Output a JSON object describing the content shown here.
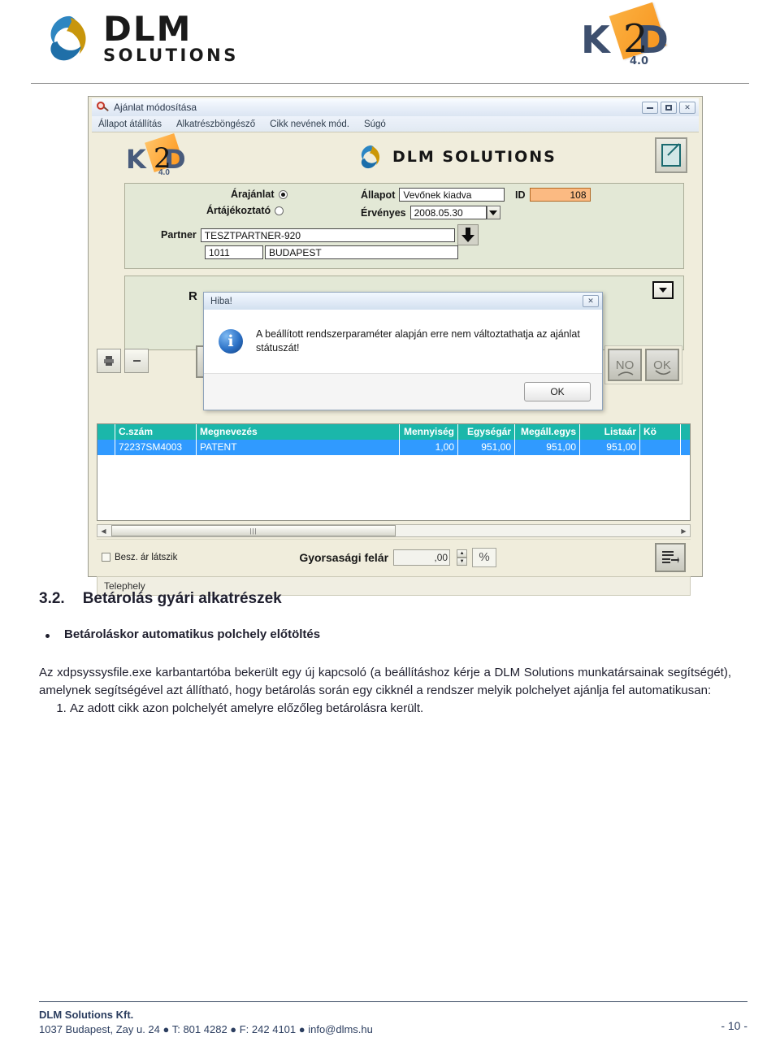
{
  "brand": {
    "dlm_top": "DLM",
    "dlm_bottom": "SOLUTIONS",
    "k2d_text": "KD",
    "k2d_two": "2",
    "k2d_version": "4.0"
  },
  "screenshot": {
    "window": {
      "title": "Ajánlat módosítása",
      "icon": "magnifier-icon",
      "buttons": {
        "minimize": "minimize-icon",
        "maximize": "maximize-icon",
        "close": "✕"
      },
      "menu": [
        "Állapot átállítás",
        "Alkatrészböngésző",
        "Cikk nevének mód.",
        "Súgó"
      ]
    },
    "app_logo": {
      "k2d": "KD",
      "k2d_two": "2",
      "k2d_version": "4.0",
      "dlm_word": "DLM  SOLUTIONS"
    },
    "form": {
      "radio_quote_label": "Árajánlat",
      "radio_info_label": "Ártájékoztató",
      "radio_selected": "Árajánlat",
      "status_label": "Állapot",
      "status_value": "Vevőnek kiadva",
      "id_label": "ID",
      "id_value": "108",
      "valid_label": "Érvényes",
      "valid_value": "2008.05.30",
      "partner_label": "Partner",
      "partner_value": "TESZTPARTNER-920",
      "zip_value": "1011",
      "city_value": "BUDAPEST",
      "r_letter": "R"
    },
    "buttons": {
      "no_label": "NO",
      "ok_label": "OK"
    },
    "grid": {
      "headers": [
        "",
        "C.szám",
        "Megnevezés",
        "Mennyiség",
        "Egységár",
        "Megáll.egys",
        "Listaár",
        "Kö"
      ],
      "rows": [
        {
          "sel": "",
          "cikkszam": "72237SM4003",
          "megnevezes": "PATENT",
          "mennyiseg": "1,00",
          "egysegar": "951,00",
          "megall_egys": "951,00",
          "listaar": "951,00",
          "ko": ""
        }
      ]
    },
    "footer_controls": {
      "checkbox_label": "Besz. ár látszik",
      "checkbox_checked": false,
      "surcharge_label": "Gyorsasági felár",
      "surcharge_value": ",00",
      "percent_label": "%",
      "export_icon": "export-list-icon"
    },
    "status_bar": {
      "text": "Telephely"
    },
    "dialog": {
      "title": "Hiba!",
      "close": "✕",
      "icon": "info-icon",
      "icon_glyph": "i",
      "message": "A beállított rendszerparaméter alapján erre nem változtathatja az ajánlat státuszát!",
      "ok_label": "OK"
    }
  },
  "document": {
    "section_number": "3.2.",
    "section_title": "Betárolás gyári alkatrészek",
    "bullet": "Betároláskor automatikus polchely előtöltés",
    "paragraph": "Az xdpsyssysfile.exe karbantartóba bekerült egy új kapcsoló (a beállításhoz kérje a DLM Solutions munkatársainak segítségét), amelynek segítségével azt állítható, hogy betárolás során egy cikknél a rendszer melyik polchelyet ajánlja fel automatikusan:",
    "list_item_1": "Az adott cikk azon polchelyét amelyre előzőleg betárolásra került."
  },
  "page_footer": {
    "company": "DLM Solutions Kft.",
    "address": "1037 Budapest, Zay u. 24  ● T: 801 4282 ● F: 242 4101 ● info@dlms.hu",
    "page_number": "- 10 -"
  },
  "colors": {
    "brand_dark": "#2c3e60",
    "grid_header": "#1fb5a8",
    "grid_row": "#3399ff",
    "id_field": "#f6b882",
    "app_bg": "#ece9d8",
    "panel_bg": "#dfe4d3"
  }
}
